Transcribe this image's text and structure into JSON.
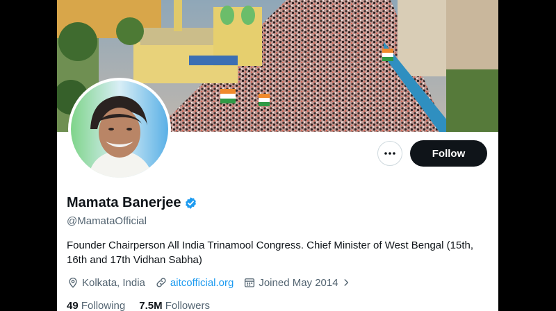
{
  "profile": {
    "name": "Mamata Banerjee",
    "handle": "@MamataOfficial",
    "bio": "Founder Chairperson All India Trinamool Congress. Chief Minister of West Bengal (15th, 16th and 17th Vidhan Sabha)",
    "location": "Kolkata, India",
    "website": "aitcofficial.org",
    "joined": "Joined May 2014",
    "following_count": "49",
    "following_label": "Following",
    "followers_count": "7.5M",
    "followers_label": "Followers"
  },
  "actions": {
    "follow_label": "Follow",
    "more_icon": "more-horizontal-icon"
  },
  "colors": {
    "verified": "#1d9bf0",
    "link": "#1d9bf0",
    "follow_bg": "#0f1419",
    "secondary_text": "#536471"
  }
}
